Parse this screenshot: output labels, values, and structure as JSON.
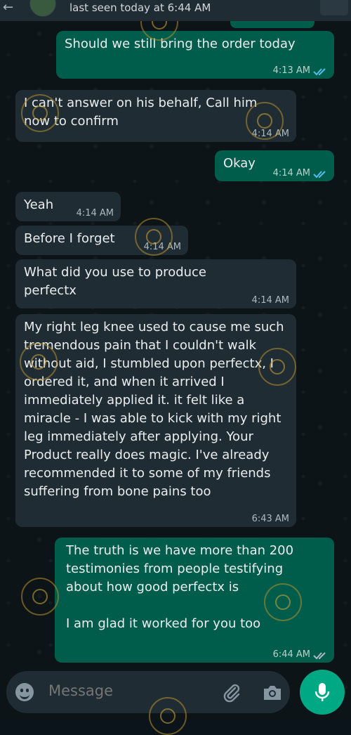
{
  "header": {
    "status": "last seen today at 6:44 AM"
  },
  "messages": [
    {
      "dir": "out",
      "text": "Should we still bring the order today",
      "time": "4:13 AM",
      "read": true
    },
    {
      "dir": "in",
      "text": "I can't answer on his behalf, Call him now to confirm",
      "time": "4:14 AM"
    },
    {
      "dir": "out",
      "text": "Okay",
      "time": "4:14 AM",
      "read": true
    },
    {
      "dir": "in",
      "text": "Yeah",
      "time": "4:14 AM"
    },
    {
      "dir": "in",
      "text": "Before I forget",
      "time": "4:14 AM"
    },
    {
      "dir": "in",
      "text": "What did you use to produce perfectx",
      "time": "4:14 AM"
    },
    {
      "dir": "in",
      "text": "My right leg knee used to cause me such tremendous pain that I couldn't walk without aid, I stumbled upon perfectx, I ordered it, and when it arrived I immediately applied it. it felt like a miracle - I was able to kick with my right leg immediately after applying. Your Product really does magic. I've already recommended it to some of my friends suffering from bone pains too",
      "time": "6:43 AM"
    },
    {
      "dir": "out",
      "text": "The truth is we have more than 200 testimonies from people testifying about how good perfectx is",
      "text2": "I am glad it worked for you too",
      "time": "6:44 AM",
      "read": false
    }
  ],
  "input": {
    "placeholder": "Message"
  },
  "icons": {
    "emoji": "emoji-icon",
    "attach": "paperclip-icon",
    "camera": "camera-icon",
    "mic": "microphone-icon",
    "ticks": "double-check-icon"
  },
  "colors": {
    "incoming": "#202c33",
    "outgoing": "#005c4b",
    "read_ticks": "#53bdeb",
    "unread_ticks": "#aebac1",
    "accent": "#00a884"
  }
}
